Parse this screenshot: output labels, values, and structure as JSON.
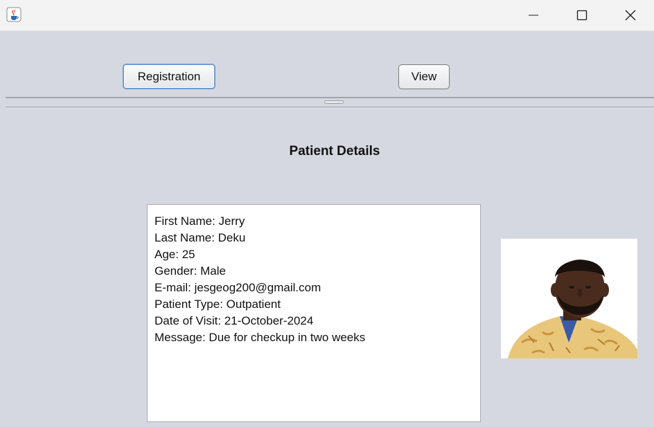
{
  "window": {
    "icon": "java-cup-icon",
    "controls": [
      "minimize-icon",
      "maximize-icon",
      "close-icon"
    ]
  },
  "toolbar": {
    "registration_label": "Registration",
    "view_label": "View"
  },
  "heading": "Patient Details",
  "details": {
    "lines": [
      "First Name: Jerry",
      "Last Name: Deku",
      "Age: 25",
      "Gender: Male",
      "E-mail: jesgeog200@gmail.com",
      "Patient Type: Outpatient",
      "Date of Visit: 21-October-2024",
      "Message: Due for checkup in two weeks"
    ]
  },
  "photo": {
    "subject": "patient-photo",
    "colors": {
      "background": "#ffffff",
      "skin": "#4a2c1e",
      "shirt": "#e9c77a"
    }
  }
}
